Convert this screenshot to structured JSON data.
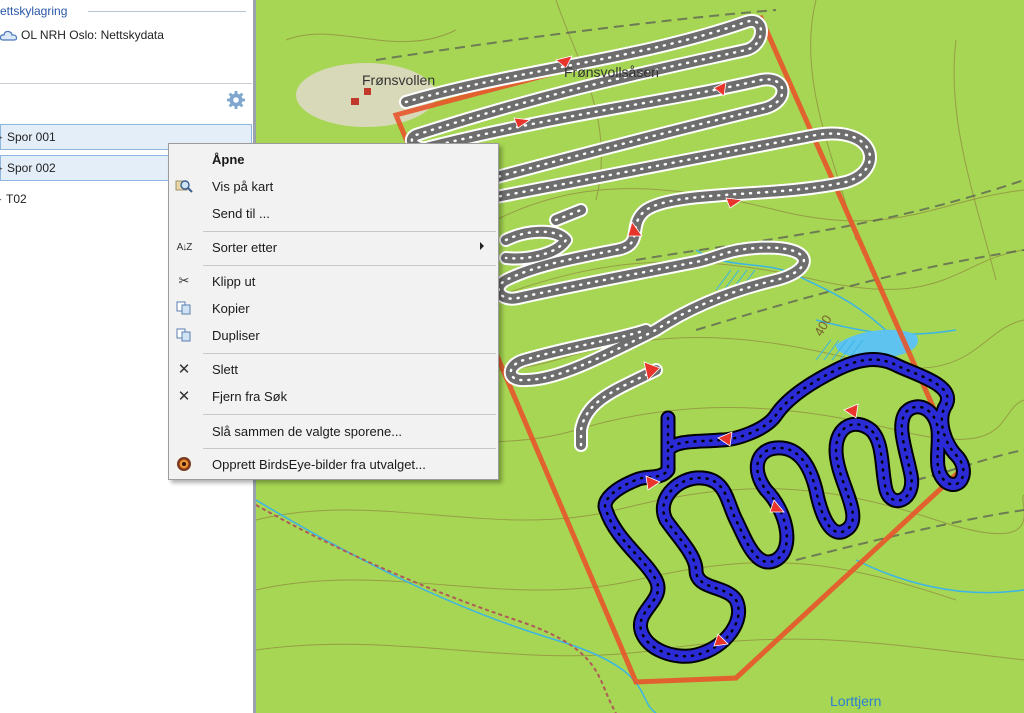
{
  "left_panel": {
    "cloud_header": "ettskylagring",
    "cloud_item": "OL NRH Oslo: Nettskydata",
    "tracks_header_glyph": ":",
    "tracks": [
      {
        "label": "Spor 001",
        "selected": true
      },
      {
        "label": "Spor 002",
        "selected": true
      },
      {
        "label": "T02",
        "selected": false
      }
    ]
  },
  "map": {
    "labels": {
      "fronsvollen": "Frønsvollen",
      "fronsvollsasen": "Frønsvollsåsen",
      "contour_400": "400",
      "lorttjern": "Lorttjern"
    },
    "colors": {
      "land": "#a6d653",
      "boundary": "#e8542b",
      "grey_track": "#6e6e6e",
      "blue_track": "#2b2bd6",
      "water": "#5fc3f0"
    }
  },
  "context_menu": {
    "items": [
      {
        "label": "Åpne",
        "icon": "none",
        "bold": true
      },
      {
        "label": "Vis på kart",
        "icon": "magnifier-map-icon"
      },
      {
        "label": "Send til ...",
        "icon": "none"
      },
      {
        "label": "Sorter etter",
        "icon": "sort-az-icon",
        "submenu": true
      },
      {
        "label": "Klipp ut",
        "icon": "scissors-icon"
      },
      {
        "label": "Kopier",
        "icon": "copy-icon"
      },
      {
        "label": "Dupliser",
        "icon": "duplicate-icon"
      },
      {
        "label": "Slett",
        "icon": "delete-x-icon"
      },
      {
        "label": "Fjern fra Søk",
        "icon": "remove-x-icon"
      },
      {
        "label": "Slå sammen de valgte sporene...",
        "icon": "none"
      },
      {
        "label": "Opprett BirdsEye-bilder fra utvalget...",
        "icon": "birdseye-icon"
      }
    ],
    "glyphs": {
      "sort": "A↓Z",
      "scissors": "✂",
      "x": "✕"
    }
  }
}
